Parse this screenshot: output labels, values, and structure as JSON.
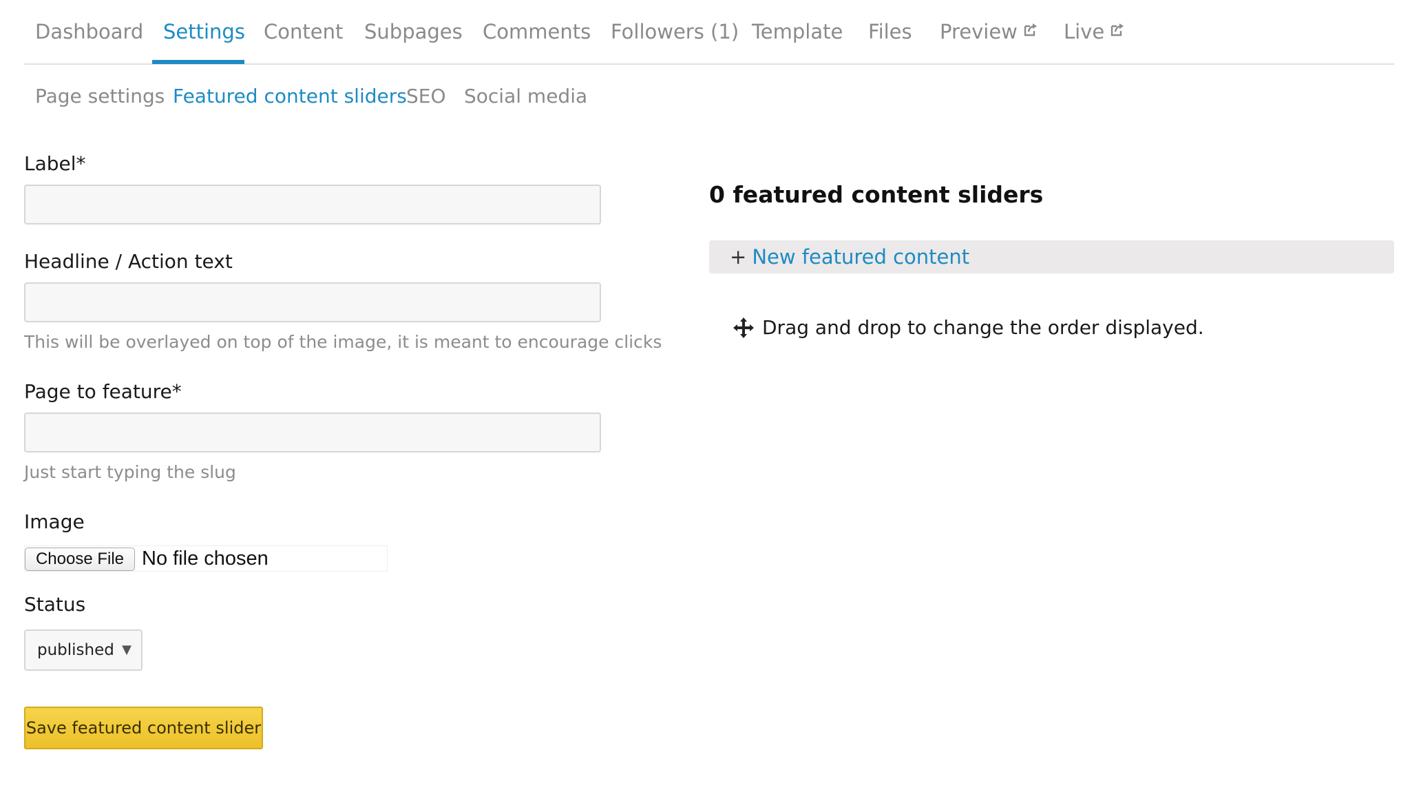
{
  "top_tabs": [
    {
      "label": "Dashboard"
    },
    {
      "label": "Settings",
      "active": true
    },
    {
      "label": "Content"
    },
    {
      "label": "Subpages"
    },
    {
      "label": "Comments"
    },
    {
      "label": "Followers (1)"
    },
    {
      "label": "Template"
    },
    {
      "label": "Files"
    },
    {
      "label": "Preview",
      "icon": "external-link-icon"
    },
    {
      "label": "Live",
      "icon": "external-link-icon"
    }
  ],
  "sub_tabs": [
    {
      "label": "Page settings"
    },
    {
      "label": "Featured content sliders",
      "active": true
    },
    {
      "label": "SEO"
    },
    {
      "label": "Social media"
    }
  ],
  "form": {
    "label_field": {
      "label": "Label*",
      "value": ""
    },
    "headline_field": {
      "label": "Headline / Action text",
      "value": "",
      "hint": "This will be overlayed on top of the image, it is meant to encourage clicks"
    },
    "page_field": {
      "label": "Page to feature*",
      "value": "",
      "hint": "Just start typing the slug"
    },
    "image_field": {
      "label": "Image",
      "button_label": "Choose File",
      "status_text": "No file chosen"
    },
    "status_field": {
      "label": "Status",
      "selected": "published"
    },
    "save_label": "Save featured content slider"
  },
  "sliders_panel": {
    "heading": "0 featured content sliders",
    "new_plus": "+",
    "new_label": "New featured content",
    "drag_hint": "Drag and drop to change the order displayed."
  },
  "colors": {
    "accent": "#1d8bc4",
    "tab_inactive": "#8a8a8a",
    "save_button": "#ecc02a",
    "new_bar_bg": "#ebe9e9"
  }
}
